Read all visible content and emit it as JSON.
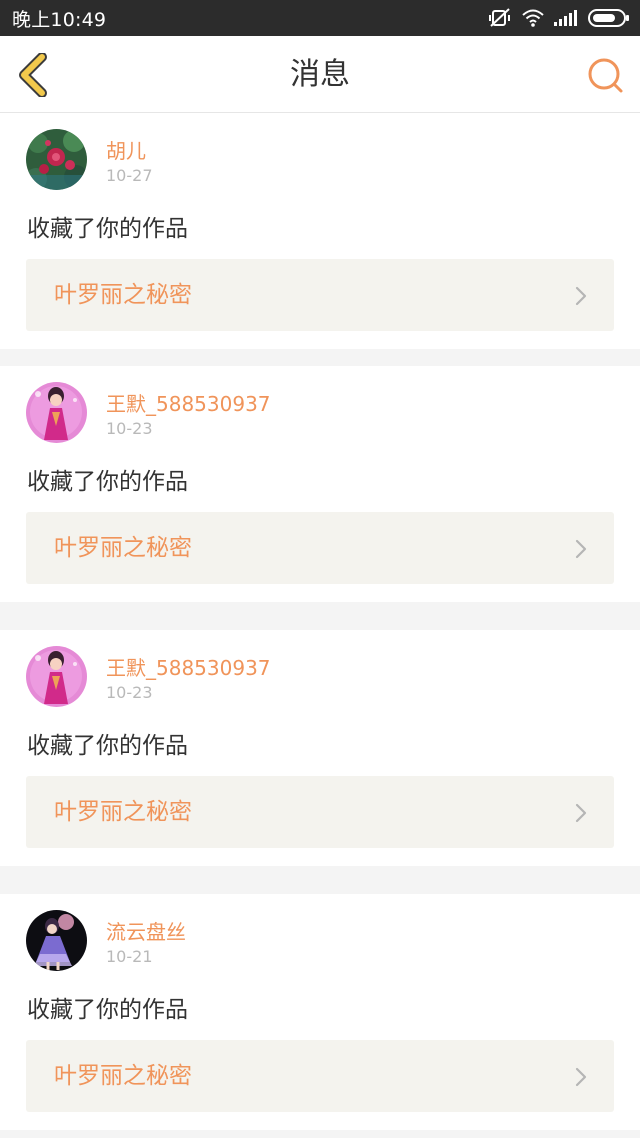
{
  "status_bar": {
    "time": "晚上10:49",
    "icons": [
      "muted-vibrate-icon",
      "wifi-icon",
      "signal-icon",
      "battery-icon"
    ]
  },
  "navbar": {
    "title": "消息",
    "back_icon": "chevron-left-icon",
    "search_icon": "search-icon"
  },
  "colors": {
    "accent": "#f0945a",
    "back_icon": "#f2c94c",
    "status_bar": "#2c2c2c",
    "background": "#f4f4f4",
    "link_box": "#f4f3ee"
  },
  "messages": [
    {
      "user": "胡儿",
      "date": "10-27",
      "action": "收藏了你的作品",
      "work": "叶罗丽之秘密",
      "avatar": "flower-avatar"
    },
    {
      "user": "王默_588530937",
      "date": "10-23",
      "action": "收藏了你的作品",
      "work": "叶罗丽之秘密",
      "avatar": "pink-doll-avatar"
    },
    {
      "user": "王默_588530937",
      "date": "10-23",
      "action": "收藏了你的作品",
      "work": "叶罗丽之秘密",
      "avatar": "pink-doll-avatar"
    },
    {
      "user": "流云盘丝",
      "date": "10-21",
      "action": "收藏了你的作品",
      "work": "叶罗丽之秘密",
      "avatar": "dark-doll-avatar"
    }
  ]
}
